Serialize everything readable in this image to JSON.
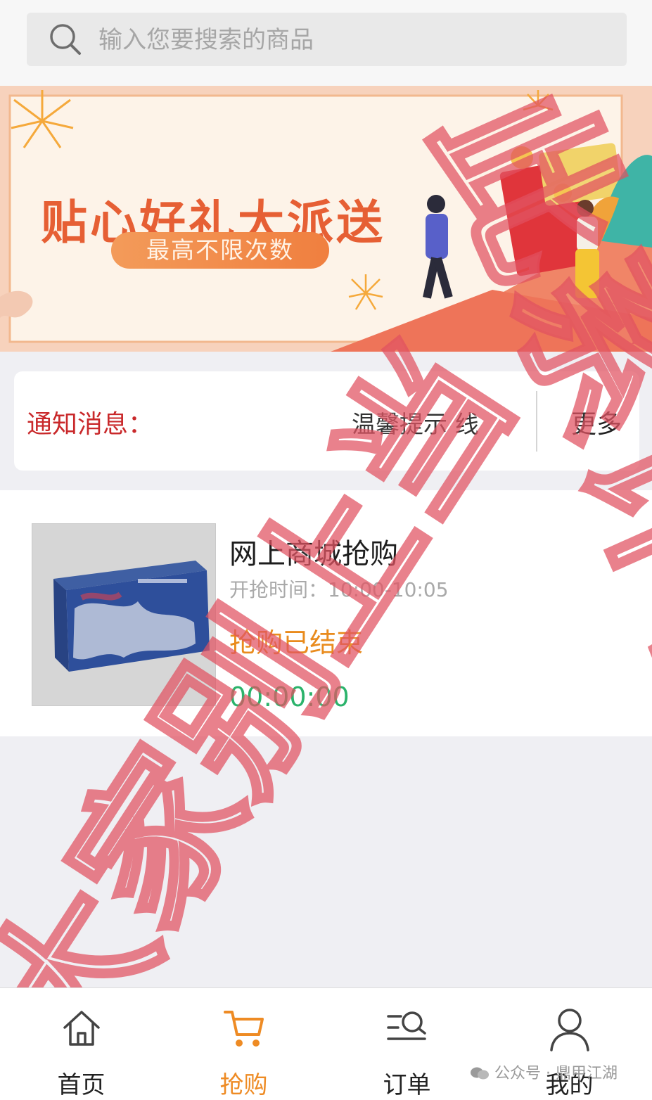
{
  "search": {
    "placeholder": "输入您要搜索的商品"
  },
  "banner": {
    "title": "贴心好礼大派送",
    "subtitle": "最高不限次数"
  },
  "notice": {
    "label": "通知消息：",
    "text": "温馨提示 线",
    "more": "更多"
  },
  "product": {
    "name": "网上商城抢购",
    "time_label": "开抢时间：",
    "time_value": "10:00-10:05",
    "status": "抢购已结束",
    "countdown": "00:00:00"
  },
  "watermark": {
    "lines": [
      "此系诈骗",
      "大家别上当"
    ]
  },
  "tabbar": {
    "items": [
      {
        "label": "首页",
        "icon": "home-icon",
        "active": false
      },
      {
        "label": "抢购",
        "icon": "cart-icon",
        "active": true
      },
      {
        "label": "订单",
        "icon": "order-list-icon",
        "active": false
      },
      {
        "label": "我的",
        "icon": "user-icon",
        "active": false
      }
    ],
    "active_color": "#ee8b24"
  },
  "footer_tag": {
    "prefix": "公众号 · ",
    "name": "鼎甲江湖"
  },
  "colors": {
    "notice_label": "#c9292b",
    "status": "#e98b1d",
    "countdown": "#2bb36b",
    "watermark": "#e0505f"
  }
}
